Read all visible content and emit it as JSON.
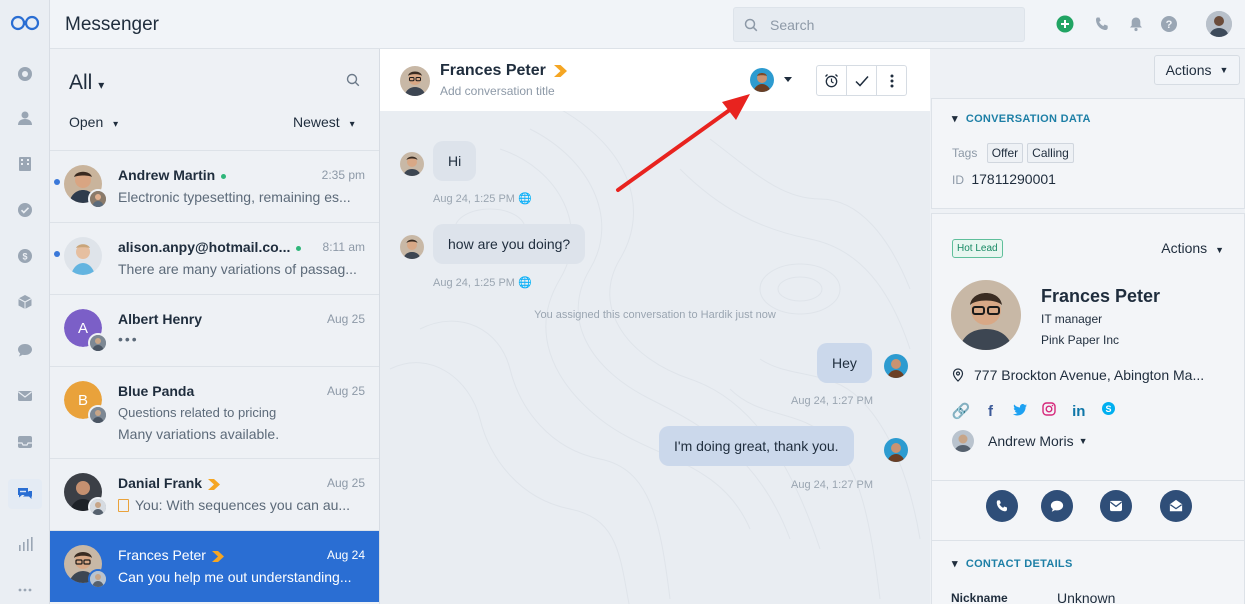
{
  "app": {
    "title": "Messenger",
    "search_placeholder": "Search"
  },
  "list": {
    "filter": "All",
    "status_filter": "Open",
    "sort": "Newest",
    "conversations": [
      {
        "name": "Andrew Martin",
        "time": "2:35 pm",
        "snippet": "Electronic typesetting, remaining es...",
        "unread": true,
        "online": true
      },
      {
        "name": "alison.anpy@hotmail.co...",
        "time": "8:11 am",
        "snippet": "There are many variations of passag...",
        "unread": true,
        "online": true
      },
      {
        "name": "Albert Henry",
        "time": "Aug 25",
        "snippet": "•••",
        "letter": "A",
        "letter_color": "#7b5fc7"
      },
      {
        "name": "Blue Panda",
        "time": "Aug 25",
        "snippet": "Questions related to pricing",
        "snippet2": "Many variations available.",
        "letter": "B",
        "letter_color": "#e9a23b"
      },
      {
        "name": "Danial Frank",
        "time": "Aug 25",
        "snippet": "You: With sequences you can au...",
        "lead": true
      },
      {
        "name": "Frances Peter",
        "time": "Aug 24",
        "snippet": "Can you help me out understanding...",
        "lead": true,
        "selected": true
      }
    ]
  },
  "chat": {
    "contact_name": "Frances Peter",
    "title_placeholder": "Add conversation title",
    "messages": [
      {
        "dir": "in",
        "text": "Hi",
        "meta": "Aug 24, 1:25 PM"
      },
      {
        "dir": "in",
        "text": "how are you doing?",
        "meta": "Aug 24, 1:25 PM"
      },
      {
        "dir": "system",
        "text": "You assigned this conversation to Hardik just now"
      },
      {
        "dir": "out",
        "text": "Hey",
        "meta": "Aug 24, 1:27 PM"
      },
      {
        "dir": "out",
        "text": "I'm doing great, thank you.",
        "meta": "Aug 24, 1:27 PM"
      }
    ]
  },
  "right": {
    "actions_label": "Actions",
    "conversation_data": {
      "title": "CONVERSATION DATA",
      "tags_label": "Tags",
      "tags": [
        "Offer",
        "Calling"
      ],
      "id_label": "ID",
      "id_value": "17811290001"
    },
    "contact": {
      "badge": "Hot Lead",
      "actions_label": "Actions",
      "name": "Frances Peter",
      "job_title": "IT manager",
      "company": "Pink Paper Inc",
      "address": "777 Brockton Avenue, Abington Ma...",
      "owner": "Andrew Moris"
    },
    "contact_details": {
      "title": "CONTACT DETAILS",
      "nickname_label": "Nickname",
      "nickname_value": "Unknown"
    }
  },
  "colors": {
    "accent": "#2a6ed3",
    "lead": "#f5a623",
    "online": "#2fb67a",
    "section_title": "#1d7fa6",
    "arrow": "#e8231f"
  }
}
